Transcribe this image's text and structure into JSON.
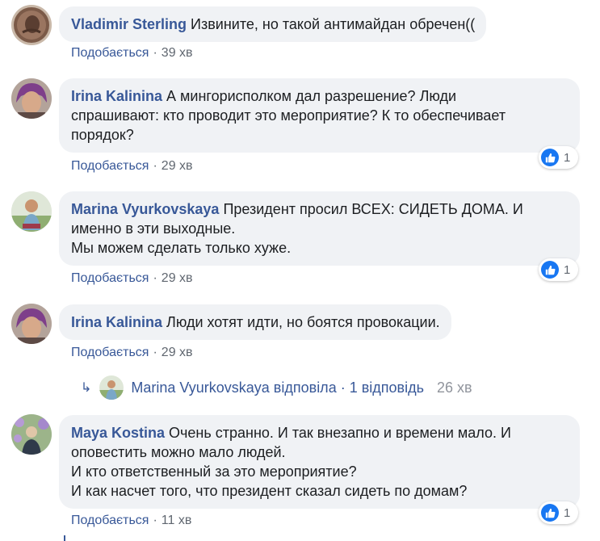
{
  "comments": [
    {
      "author": "Vladimir Sterling",
      "text": "Извините, но такой антимайдан обречен((",
      "like_label": "Подобається",
      "time": "39 хв",
      "reactions": ""
    },
    {
      "author": "Irina Kalinina",
      "text": "А мингорисполком дал разрешение? Люди\nспрашивают: кто проводит это мероприятие? К то обеспечивает\nпорядок?",
      "like_label": "Подобається",
      "time": "29 хв",
      "reactions": "1"
    },
    {
      "author": "Marina Vyurkovskaya",
      "text": "Президент просил ВСЕХ: СИДЕТЬ ДОМА. И\nименно в эти выходные.\nМы можем сделать только хуже.",
      "like_label": "Подобається",
      "time": "29 хв",
      "reactions": "1"
    },
    {
      "author": "Irina Kalinina",
      "text": "Люди хотят идти, но боятся провокации.",
      "like_label": "Подобається",
      "time": "29 хв",
      "reactions": ""
    },
    {
      "author": "Maya Kostina",
      "text": "Очень странно. И так внезапно и времени мало. И\nоповестить можно мало людей.\nИ кто ответственный за это мероприятие?\nИ как насчет того, что президент сказал сидеть по домам?",
      "like_label": "Подобається",
      "time": "11 хв",
      "reactions": "1"
    }
  ],
  "reply_summary": {
    "text": "Marina Vyurkovskaya відповіла · 1 відповідь",
    "time": "26 хв"
  },
  "separator": "·",
  "icons": {
    "like": "thumbs-up-icon",
    "reply": "reply-arrow-icon"
  },
  "colors": {
    "author": "#385898",
    "bubble": "#f0f2f5",
    "like_blue": "#1877f2",
    "muted": "#606770"
  }
}
